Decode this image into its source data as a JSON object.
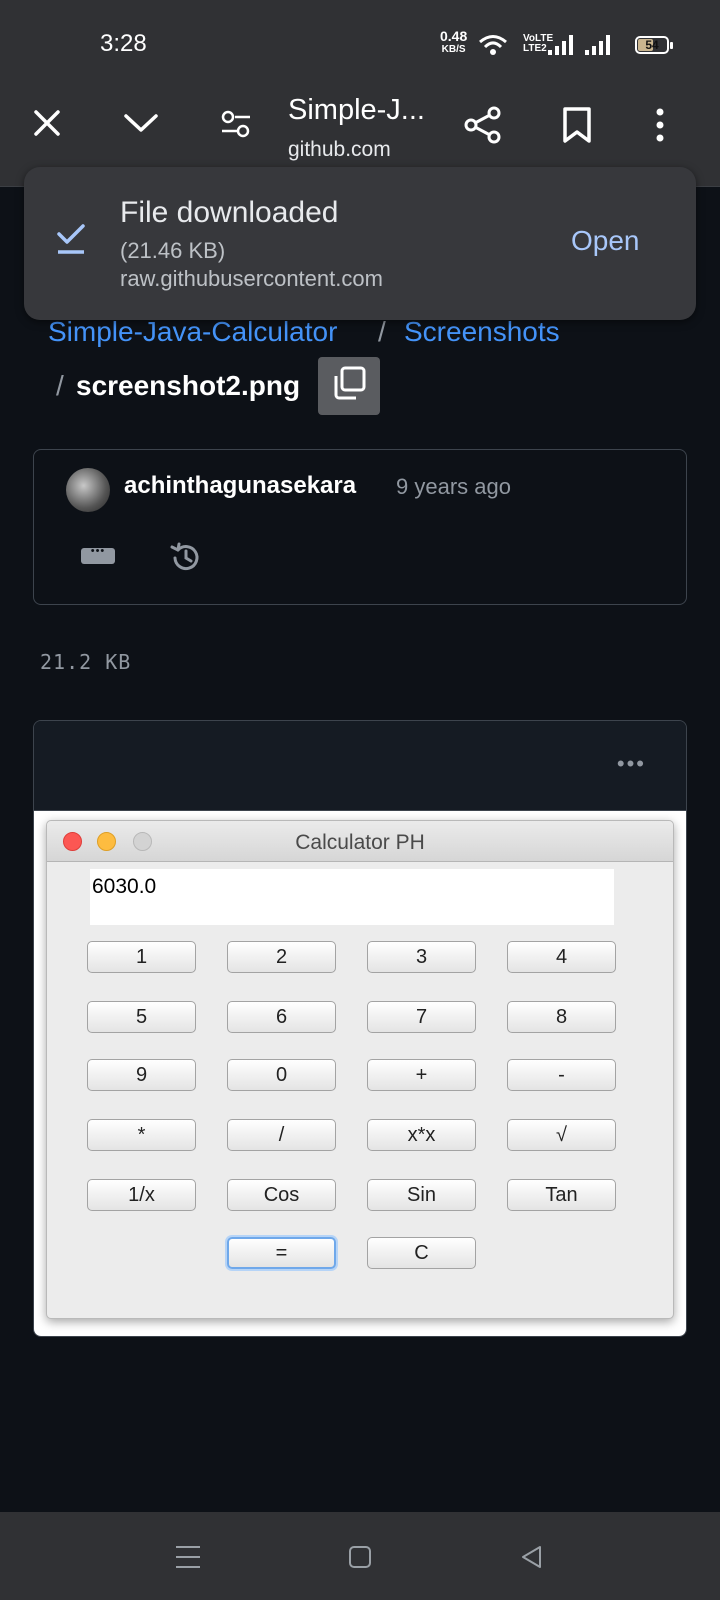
{
  "status_bar": {
    "time": "3:28",
    "net_speed": "0.48",
    "net_unit": "KB/S",
    "volte_top": "VoLTE",
    "volte_bottom": "LTE2",
    "battery": "54",
    "battery_level_percent": 54
  },
  "browser": {
    "page_title": "Simple-J...",
    "page_url": "github.com",
    "icons": [
      "close-icon",
      "chevron-down-icon",
      "tune-icon",
      "share-icon",
      "bookmark-icon",
      "more-vert-icon"
    ]
  },
  "download_snackbar": {
    "title": "File downloaded",
    "size": "(21.46 KB)",
    "source": "raw.githubusercontent.com",
    "action": "Open"
  },
  "breadcrumb": {
    "repo": "Simple-Java-Calculator",
    "separator": "/",
    "folder": "Screenshots",
    "file": "screenshot2.png"
  },
  "commit": {
    "author": "achinthagunasekara",
    "time": "9 years ago"
  },
  "file": {
    "size": "21.2 KB",
    "menu": "•••"
  },
  "calculator": {
    "window_title": "Calculator PH",
    "display": "6030.0",
    "buttons": [
      [
        "1",
        "2",
        "3",
        "4"
      ],
      [
        "5",
        "6",
        "7",
        "8"
      ],
      [
        "9",
        "0",
        "+",
        "-"
      ],
      [
        "*",
        "/",
        "x*x",
        "√"
      ],
      [
        "1/x",
        "Cos",
        "Sin",
        "Tan"
      ],
      [
        "=",
        "C"
      ]
    ]
  },
  "colors": {
    "link": "#4493f8",
    "background": "#0d1117",
    "snackbar_action": "#a8c7fa"
  }
}
